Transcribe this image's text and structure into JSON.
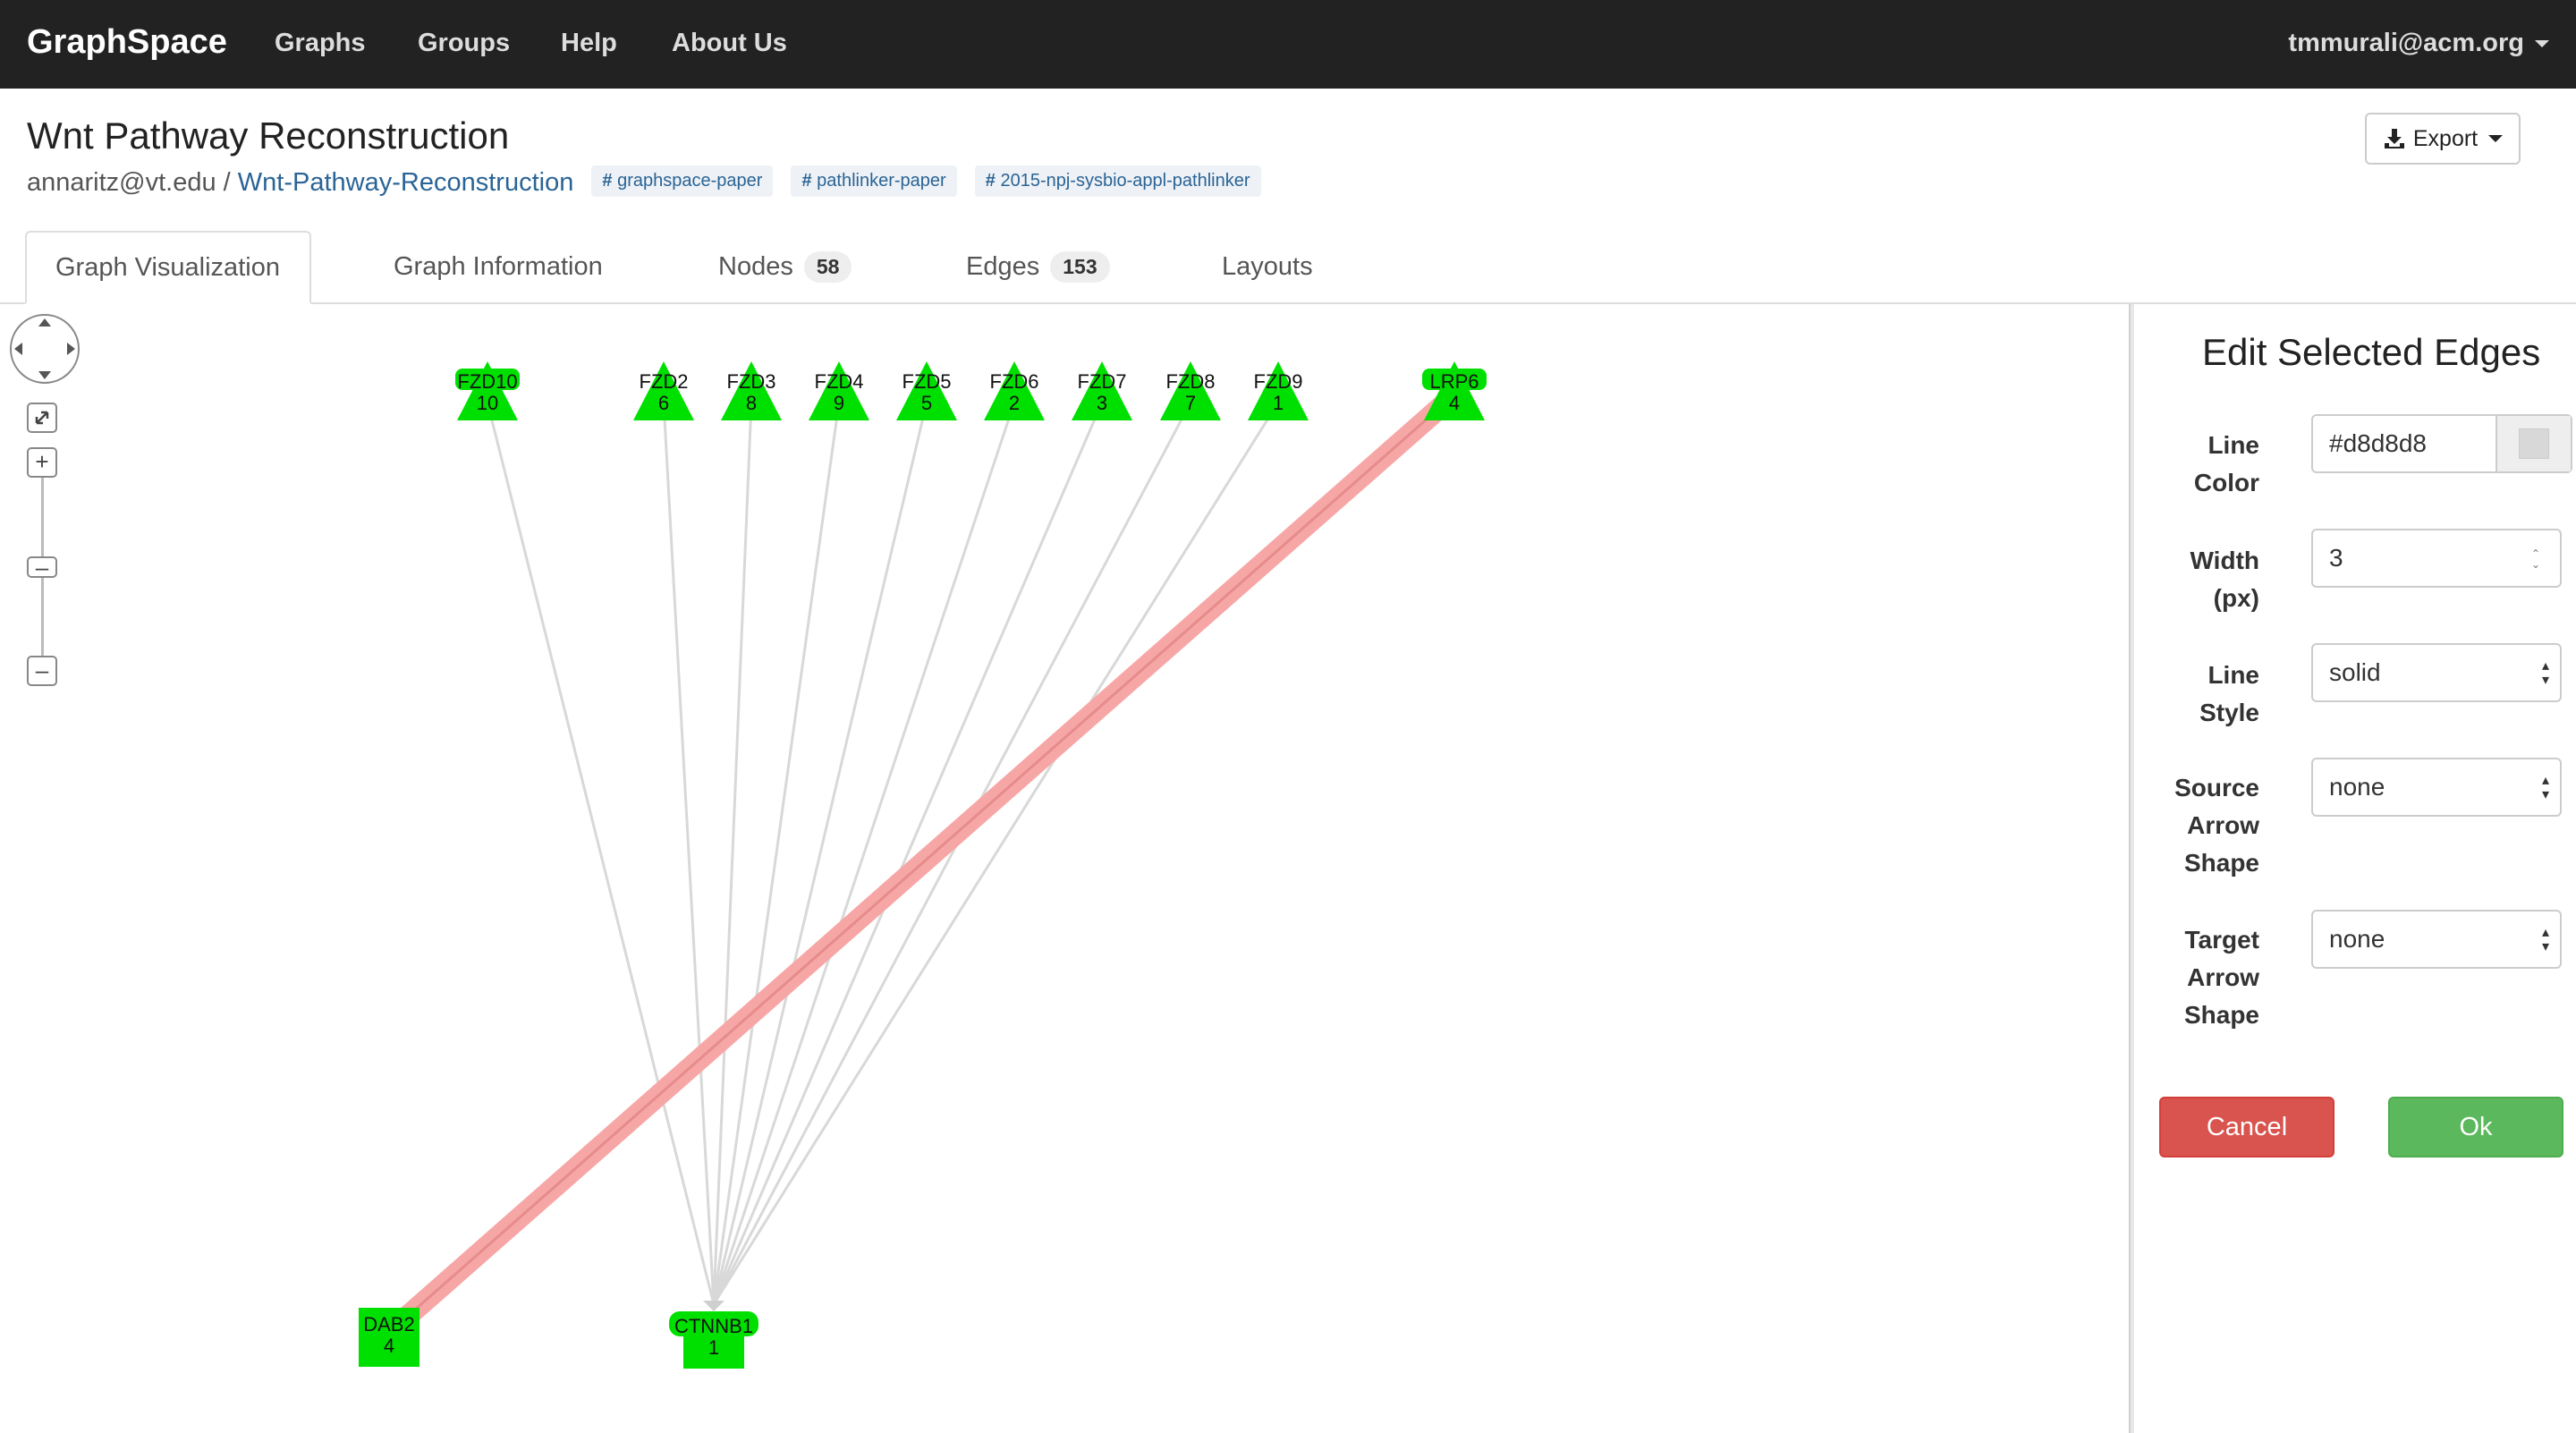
{
  "navbar": {
    "brand": "GraphSpace",
    "links": [
      "Graphs",
      "Groups",
      "Help",
      "About Us"
    ],
    "user": "tmmurali@acm.org"
  },
  "header": {
    "title": "Wnt Pathway Reconstruction",
    "owner": "annaritz@vt.edu",
    "separator": "/",
    "graph_link": "Wnt-Pathway-Reconstruction",
    "tags": [
      "graphspace-paper",
      "pathlinker-paper",
      "2015-npj-sysbio-appl-pathlinker"
    ],
    "export_label": "Export"
  },
  "tabs": [
    {
      "label": "Graph Visualization",
      "active": true
    },
    {
      "label": "Graph Information"
    },
    {
      "label": "Nodes",
      "count": "58"
    },
    {
      "label": "Edges",
      "count": "153"
    },
    {
      "label": "Layouts"
    }
  ],
  "graph": {
    "nodes": [
      {
        "id": "FZD10",
        "label": "FZD10",
        "num": "10",
        "shape": "triangle"
      },
      {
        "id": "FZD2",
        "label": "FZD2",
        "num": "6",
        "shape": "triangle"
      },
      {
        "id": "FZD3",
        "label": "FZD3",
        "num": "8",
        "shape": "triangle"
      },
      {
        "id": "FZD4",
        "label": "FZD4",
        "num": "9",
        "shape": "triangle"
      },
      {
        "id": "FZD5",
        "label": "FZD5",
        "num": "5",
        "shape": "triangle"
      },
      {
        "id": "FZD6",
        "label": "FZD6",
        "num": "2",
        "shape": "triangle"
      },
      {
        "id": "FZD7",
        "label": "FZD7",
        "num": "3",
        "shape": "triangle"
      },
      {
        "id": "FZD8",
        "label": "FZD8",
        "num": "7",
        "shape": "triangle"
      },
      {
        "id": "FZD9",
        "label": "FZD9",
        "num": "1",
        "shape": "triangle"
      },
      {
        "id": "LRP6",
        "label": "LRP6",
        "num": "4",
        "shape": "triangle"
      },
      {
        "id": "DAB2",
        "label": "DAB2",
        "num": "4",
        "shape": "rectangle"
      },
      {
        "id": "CTNNB1",
        "label": "CTNNB1",
        "num": "1",
        "shape": "rectangle"
      }
    ],
    "edges": [
      {
        "source": "FZD10",
        "target": "CTNNB1"
      },
      {
        "source": "FZD2",
        "target": "CTNNB1"
      },
      {
        "source": "FZD3",
        "target": "CTNNB1"
      },
      {
        "source": "FZD4",
        "target": "CTNNB1"
      },
      {
        "source": "FZD5",
        "target": "CTNNB1"
      },
      {
        "source": "FZD6",
        "target": "CTNNB1"
      },
      {
        "source": "FZD7",
        "target": "CTNNB1"
      },
      {
        "source": "FZD8",
        "target": "CTNNB1"
      },
      {
        "source": "FZD9",
        "target": "CTNNB1"
      },
      {
        "source": "LRP6",
        "target": "DAB2",
        "selected": true
      }
    ],
    "node_color": "#00e000",
    "edge_color": "#d8d8d8",
    "selected_edge_color": "#f7a6a6"
  },
  "panel": {
    "title": "Edit Selected Edges",
    "fields": {
      "line_color": {
        "label1": "Line",
        "label2": "Color",
        "value": "#d8d8d8"
      },
      "width": {
        "label1": "Width",
        "label2": "(px)",
        "value": "3"
      },
      "line_style": {
        "label1": "Line",
        "label2": "Style",
        "value": "solid"
      },
      "source_arrow": {
        "label1": "Source",
        "label2": "Arrow",
        "label3": "Shape",
        "value": "none"
      },
      "target_arrow": {
        "label1": "Target",
        "label2": "Arrow",
        "label3": "Shape",
        "value": "none"
      }
    },
    "cancel_label": "Cancel",
    "ok_label": "Ok"
  }
}
